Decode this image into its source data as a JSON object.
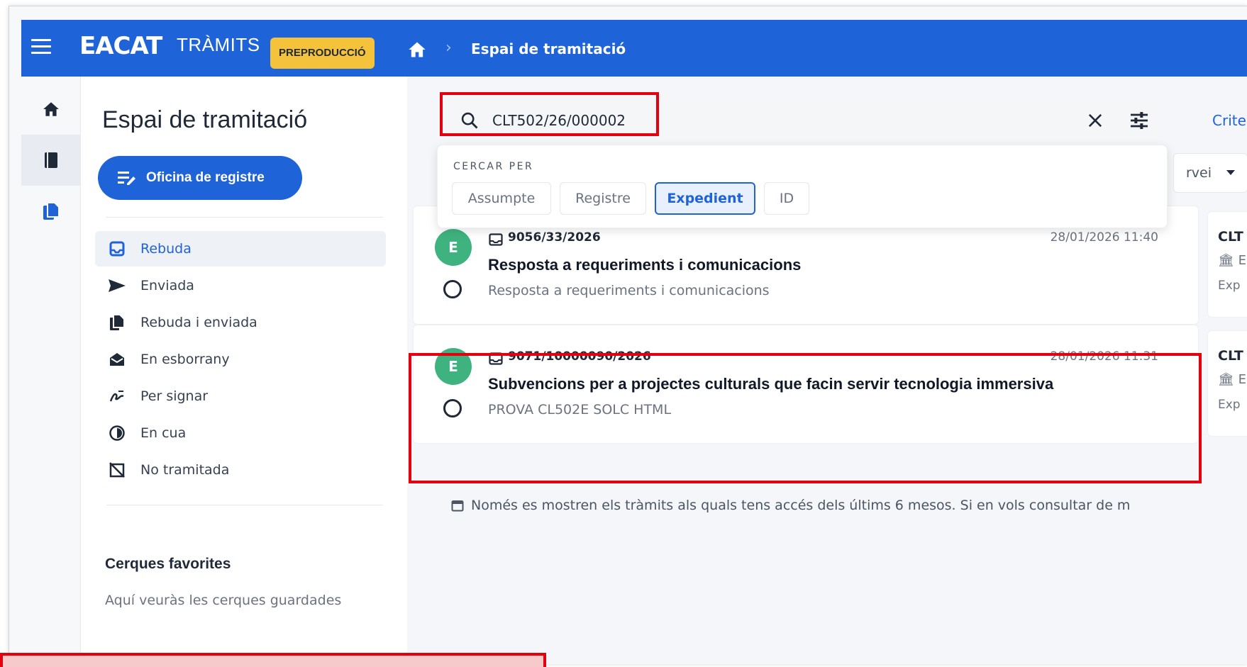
{
  "topbar": {
    "logo": "EACAT",
    "logo_sub": "TRÀMITS",
    "env_badge": "PREPRODUCCIÓ",
    "breadcrumb_current": "Espai de tramitació"
  },
  "sidebar": {
    "title": "Espai de tramitació",
    "primary_button": "Oficina de registre",
    "items": [
      {
        "label": "Rebuda",
        "icon": "inbox-icon",
        "active": true
      },
      {
        "label": "Enviada",
        "icon": "send-icon",
        "active": false
      },
      {
        "label": "Rebuda i enviada",
        "icon": "copy-icon",
        "active": false
      },
      {
        "label": "En esborrany",
        "icon": "draft-mail-icon",
        "active": false
      },
      {
        "label": "Per signar",
        "icon": "signature-icon",
        "active": false
      },
      {
        "label": "En cua",
        "icon": "queue-clock-icon",
        "active": false
      },
      {
        "label": "No tramitada",
        "icon": "not-processed-icon",
        "active": false
      }
    ],
    "favorites_title": "Cerques favorites",
    "favorites_empty": "Aquí veuràs les cerques guardades"
  },
  "search": {
    "value": "CLT502/26/000002",
    "criteria_link": "Crite",
    "service_select": "rvei",
    "dropdown_label": "CERCAR PER",
    "chips": [
      {
        "label": "Assumpte",
        "active": false
      },
      {
        "label": "Registre",
        "active": false
      },
      {
        "label": "Expedient",
        "active": true
      },
      {
        "label": "ID",
        "active": false
      }
    ]
  },
  "results": [
    {
      "avatar": "E",
      "reg_number": "9056/33/2026",
      "date": "28/01/2026 11:40",
      "title": "Resposta a requeriments i comunicacions",
      "subtitle": "Resposta a requeriments i comunicacions",
      "side": {
        "code": "CLT",
        "line2": "🏛 E",
        "line3": "Exp"
      }
    },
    {
      "avatar": "E",
      "reg_number": "9071/10000090/2026",
      "date": "28/01/2026 11:31",
      "title": "Subvencions per a projectes culturals que facin servir tecnologia immersiva",
      "subtitle": "PROVA CL502E SOLC HTML",
      "side": {
        "code": "CLT",
        "line2": "🏛 E",
        "line3": "Exp"
      }
    }
  ],
  "info_note": "Només es mostren els tràmits als quals tens accés dels últims 6 mesos. Si en vols consultar de m",
  "colors": {
    "primary": "#1f63d8",
    "badge": "#f5c33b",
    "avatar": "#3fb37f",
    "annotation": "#e3000f"
  }
}
